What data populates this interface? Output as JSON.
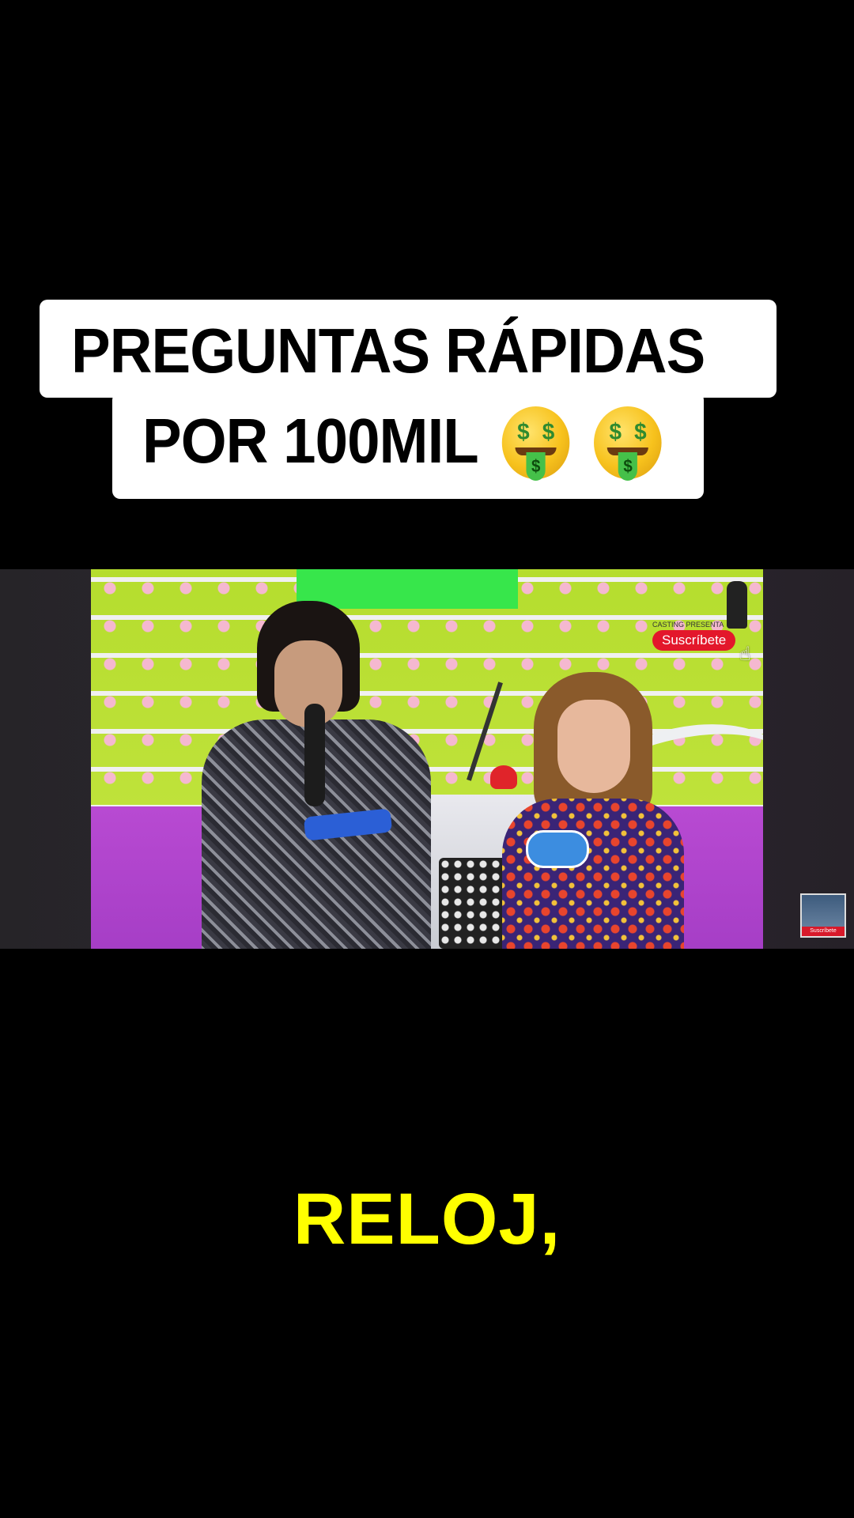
{
  "caption": {
    "line1": "PREGUNTAS RÁPIDAS",
    "line2": "POR 100MIL",
    "emoji": "money-mouth-face",
    "emoji_count": 2
  },
  "video": {
    "watermark_text": "CASTING PRESENTA",
    "subscribe_label": "Suscríbete",
    "thumbnail_label": "Suscríbete"
  },
  "subtitle": "RELOJ,",
  "colors": {
    "background": "#000000",
    "caption_bg": "#ffffff",
    "subtitle": "#ffff00",
    "subscribe": "#e3172b"
  }
}
